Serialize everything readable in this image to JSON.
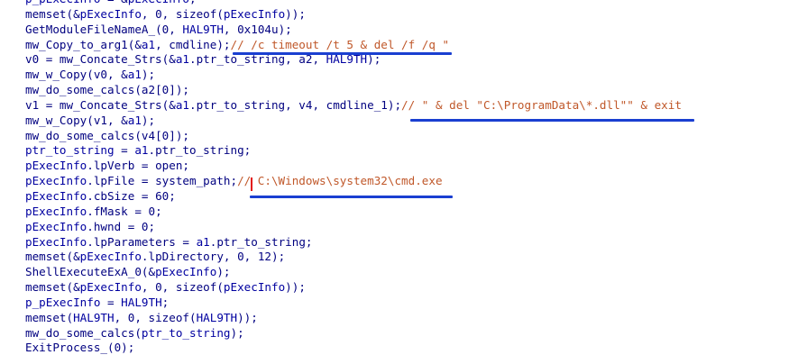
{
  "code_lines": [
    [
      {
        "t": "p_pExecInfo",
        "k": "var"
      },
      {
        "t": " = &",
        "k": "punc"
      },
      {
        "t": "pExecInfo",
        "k": "var"
      },
      {
        "t": ";",
        "k": "punc"
      }
    ],
    [
      {
        "t": "memset",
        "k": "func"
      },
      {
        "t": "(&",
        "k": "punc"
      },
      {
        "t": "pExecInfo",
        "k": "var"
      },
      {
        "t": ", 0, sizeof(",
        "k": "punc"
      },
      {
        "t": "pExecInfo",
        "k": "var"
      },
      {
        "t": "));",
        "k": "punc"
      }
    ],
    [
      {
        "t": "GetModuleFileNameA_",
        "k": "func"
      },
      {
        "t": "(0, ",
        "k": "punc"
      },
      {
        "t": "HAL9TH",
        "k": "var"
      },
      {
        "t": ", 0x104u);",
        "k": "punc"
      }
    ],
    [
      {
        "t": "mw_Copy_to_arg1",
        "k": "func"
      },
      {
        "t": "(&",
        "k": "punc"
      },
      {
        "t": "a1",
        "k": "var"
      },
      {
        "t": ", cmdline);",
        "k": "punc"
      },
      {
        "t": "// /c timeout /t 5 & del /f /q \"",
        "k": "comment"
      }
    ],
    [
      {
        "t": "v0 = mw_Concate_Strs(&",
        "k": "func"
      },
      {
        "t": "a1",
        "k": "var"
      },
      {
        "t": ".ptr_to_string, a2, ",
        "k": "punc"
      },
      {
        "t": "HAL9TH",
        "k": "var"
      },
      {
        "t": ");",
        "k": "punc"
      }
    ],
    [
      {
        "t": "mw_w_Copy",
        "k": "func"
      },
      {
        "t": "(v0, &",
        "k": "punc"
      },
      {
        "t": "a1",
        "k": "var"
      },
      {
        "t": ");",
        "k": "punc"
      }
    ],
    [
      {
        "t": "mw_do_some_calcs",
        "k": "func"
      },
      {
        "t": "(a2[0]);",
        "k": "punc"
      }
    ],
    [
      {
        "t": "v1 = mw_Concate_Strs(&",
        "k": "func"
      },
      {
        "t": "a1",
        "k": "var"
      },
      {
        "t": ".ptr_to_string, v4, cmdline_1);",
        "k": "punc"
      },
      {
        "t": "// \" & del \"C:\\ProgramData\\*.dll\"\" & exit",
        "k": "comment"
      }
    ],
    [
      {
        "t": "mw_w_Copy",
        "k": "func"
      },
      {
        "t": "(v1, &",
        "k": "punc"
      },
      {
        "t": "a1",
        "k": "var"
      },
      {
        "t": ");",
        "k": "punc"
      }
    ],
    [
      {
        "t": "mw_do_some_calcs",
        "k": "func"
      },
      {
        "t": "(v4[0]);",
        "k": "punc"
      }
    ],
    [
      {
        "t": "ptr_to_string",
        "k": "var"
      },
      {
        "t": " = ",
        "k": "punc"
      },
      {
        "t": "a1",
        "k": "var"
      },
      {
        "t": ".ptr_to_string;",
        "k": "punc"
      }
    ],
    [
      {
        "t": "pExecInfo",
        "k": "var"
      },
      {
        "t": ".lpVerb = open;",
        "k": "punc"
      }
    ],
    [
      {
        "t": "pExecInfo",
        "k": "var"
      },
      {
        "t": ".lpFile = system_path;",
        "k": "punc"
      },
      {
        "t": "// C:\\Windows\\system32\\cmd.exe",
        "k": "comment"
      }
    ],
    [
      {
        "t": "pExecInfo",
        "k": "var"
      },
      {
        "t": ".cbSize = 60;",
        "k": "punc"
      }
    ],
    [
      {
        "t": "pExecInfo",
        "k": "var"
      },
      {
        "t": ".fMask = 0;",
        "k": "punc"
      }
    ],
    [
      {
        "t": "pExecInfo",
        "k": "var"
      },
      {
        "t": ".hwnd = 0;",
        "k": "punc"
      }
    ],
    [
      {
        "t": "pExecInfo",
        "k": "var"
      },
      {
        "t": ".lpParameters = ",
        "k": "punc"
      },
      {
        "t": "a1",
        "k": "var"
      },
      {
        "t": ".ptr_to_string;",
        "k": "punc"
      }
    ],
    [
      {
        "t": "memset",
        "k": "func"
      },
      {
        "t": "(&",
        "k": "punc"
      },
      {
        "t": "pExecInfo",
        "k": "var"
      },
      {
        "t": ".lpDirectory, 0, 12);",
        "k": "punc"
      }
    ],
    [
      {
        "t": "ShellExecuteExA_0",
        "k": "func"
      },
      {
        "t": "(&",
        "k": "punc"
      },
      {
        "t": "pExecInfo",
        "k": "var"
      },
      {
        "t": ");",
        "k": "punc"
      }
    ],
    [
      {
        "t": "memset",
        "k": "func"
      },
      {
        "t": "(&",
        "k": "punc"
      },
      {
        "t": "pExecInfo",
        "k": "var"
      },
      {
        "t": ", 0, sizeof(",
        "k": "punc"
      },
      {
        "t": "pExecInfo",
        "k": "var"
      },
      {
        "t": "));",
        "k": "punc"
      }
    ],
    [
      {
        "t": "p_pExecInfo",
        "k": "var"
      },
      {
        "t": " = ",
        "k": "punc"
      },
      {
        "t": "HAL9TH",
        "k": "var"
      },
      {
        "t": ";",
        "k": "punc"
      }
    ],
    [
      {
        "t": "memset",
        "k": "func"
      },
      {
        "t": "(",
        "k": "punc"
      },
      {
        "t": "HAL9TH",
        "k": "var"
      },
      {
        "t": ", 0, sizeof(",
        "k": "punc"
      },
      {
        "t": "HAL9TH",
        "k": "var"
      },
      {
        "t": "));",
        "k": "punc"
      }
    ],
    [
      {
        "t": "mw_do_some_calcs",
        "k": "func"
      },
      {
        "t": "(",
        "k": "punc"
      },
      {
        "t": "ptr_to_string",
        "k": "var"
      },
      {
        "t": ");",
        "k": "punc"
      }
    ],
    [
      {
        "t": "ExitProcess_",
        "k": "func"
      },
      {
        "t": "(0);",
        "k": "punc"
      }
    ]
  ],
  "colors": {
    "background": "#ffffff",
    "identifier": "#000080",
    "global_var": "#0000a0",
    "number": "#008000",
    "comment": "#c0582a",
    "annotation_underline": "#1a3fd1",
    "cursor": "#e31414"
  }
}
